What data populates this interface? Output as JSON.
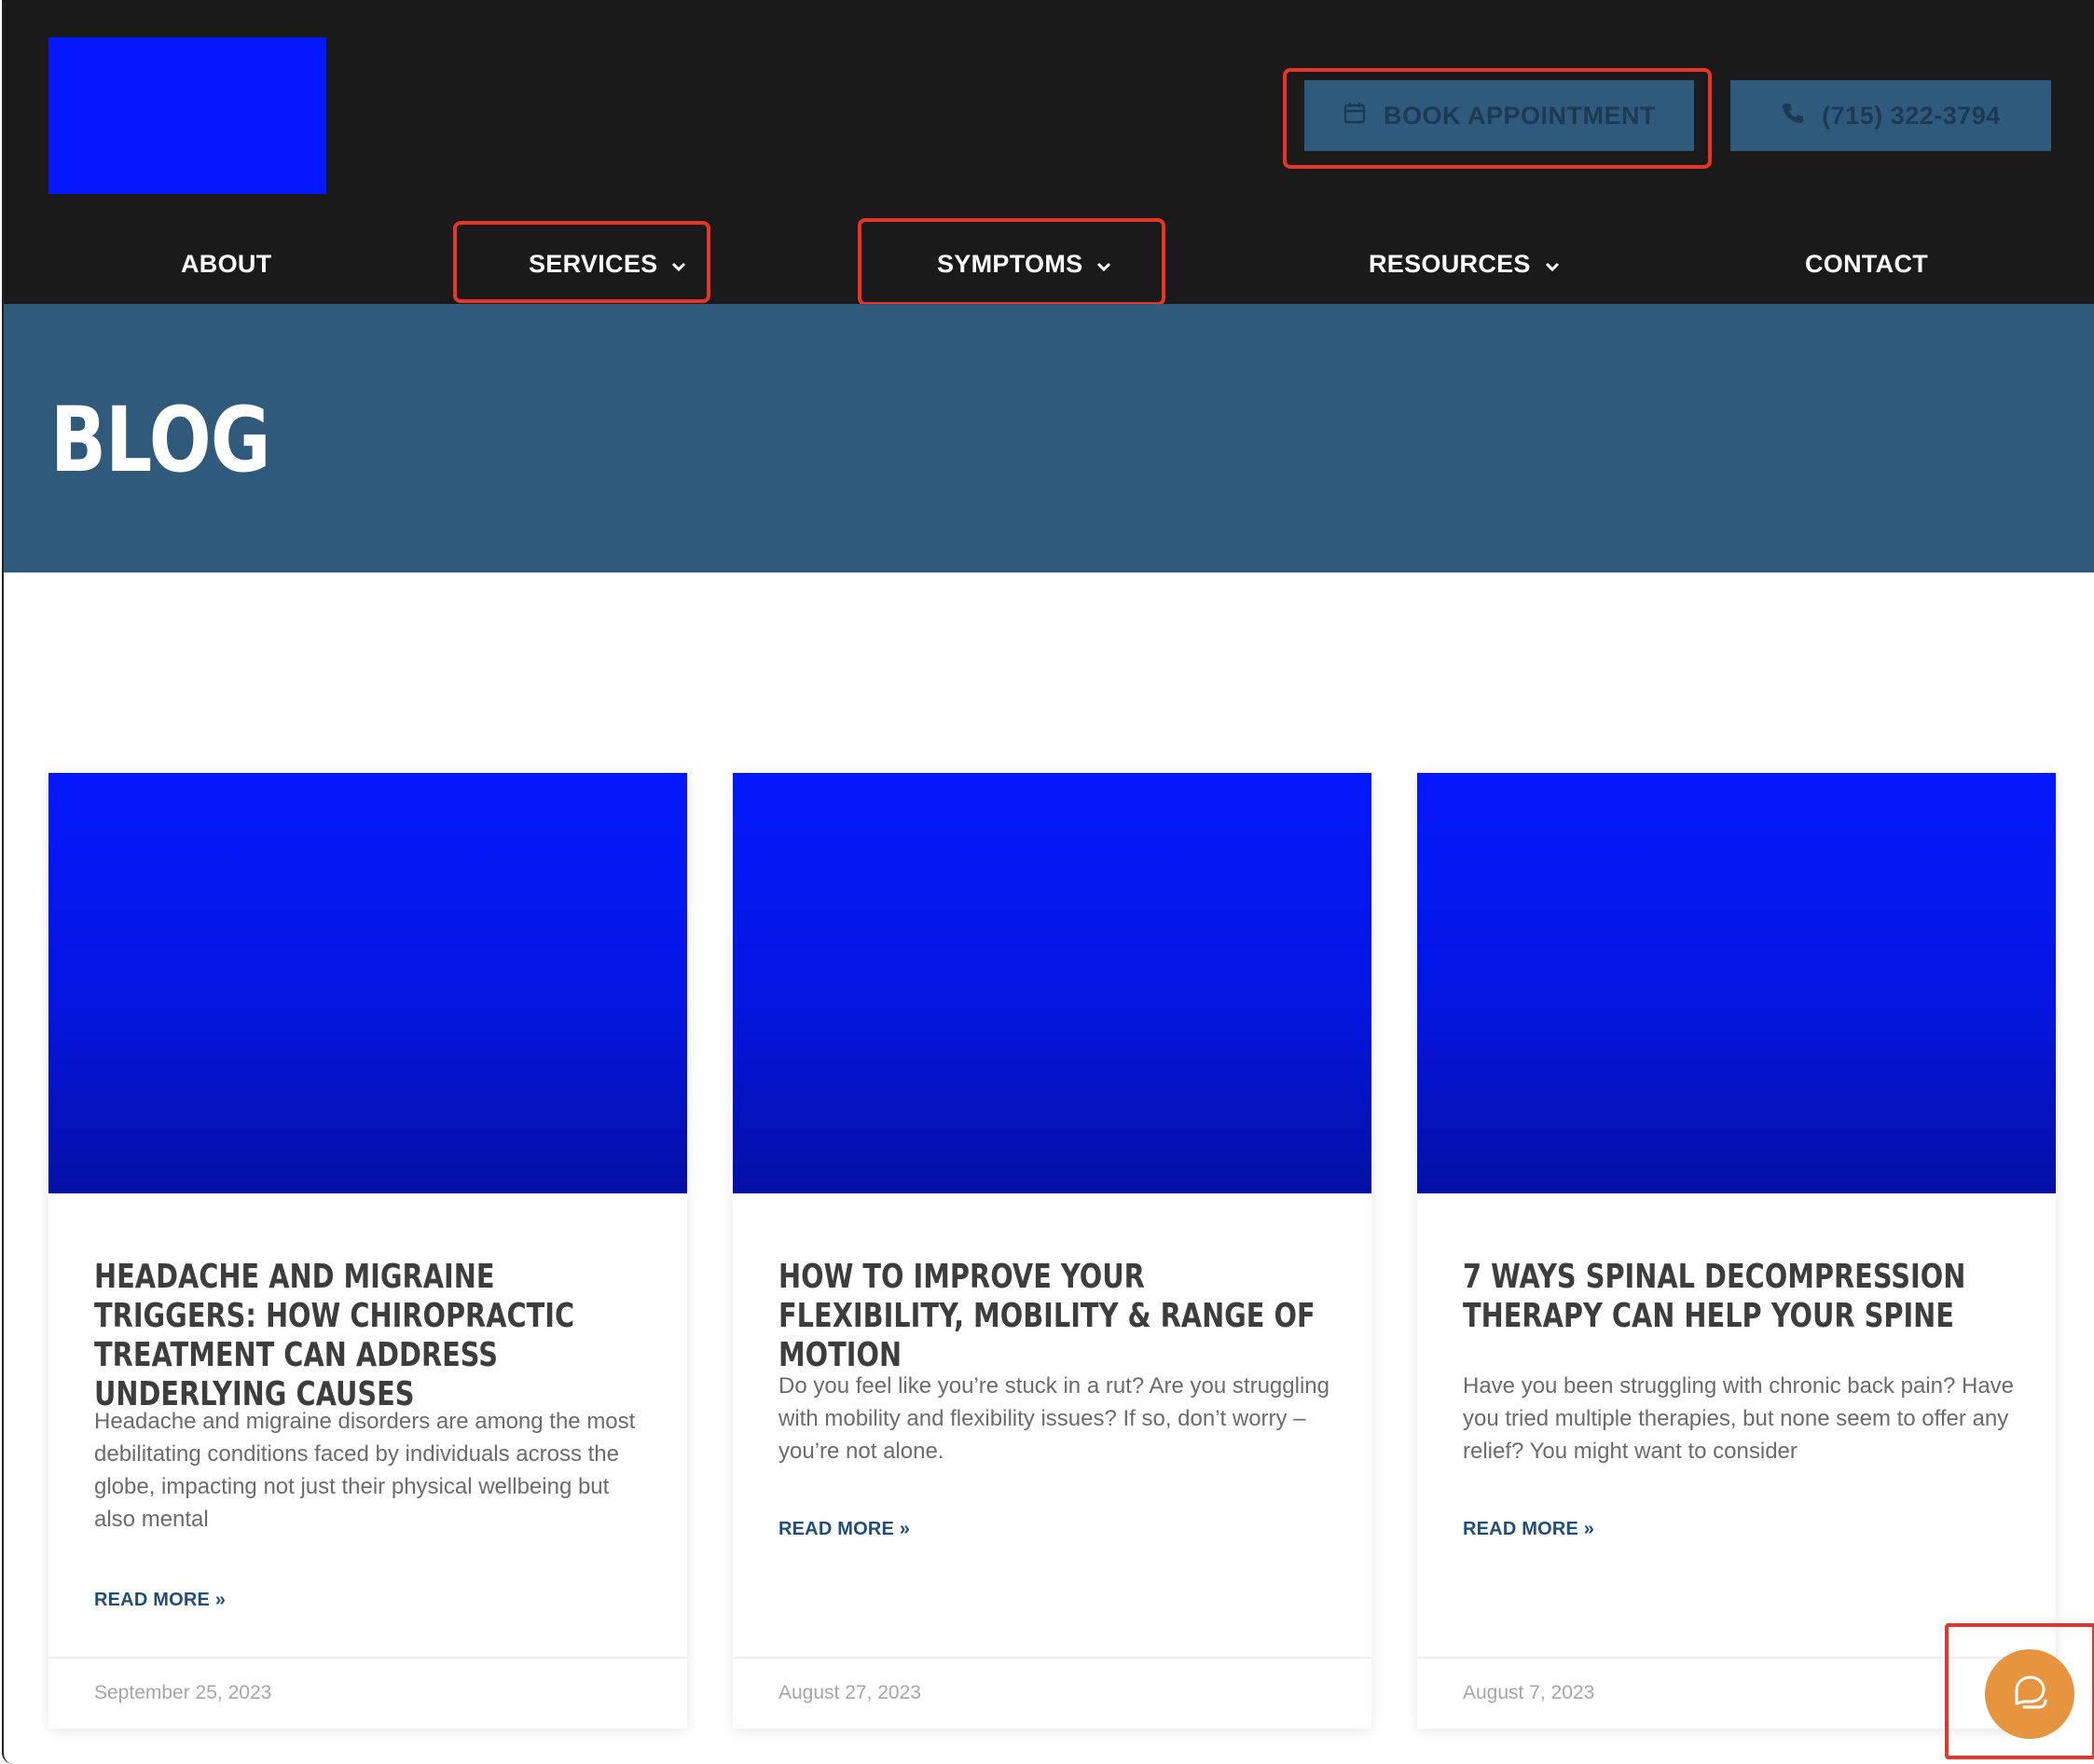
{
  "header": {
    "logo_alt": "",
    "book_label": "BOOK APPOINTMENT",
    "phone_label": "(715) 322-3794",
    "nav": [
      {
        "label": "ABOUT",
        "has_dropdown": false
      },
      {
        "label": "SERVICES",
        "has_dropdown": true
      },
      {
        "label": "SYMPTOMS",
        "has_dropdown": true
      },
      {
        "label": "RESOURCES",
        "has_dropdown": true
      },
      {
        "label": "CONTACT",
        "has_dropdown": false
      }
    ]
  },
  "hero": {
    "title": "BLOG"
  },
  "posts": [
    {
      "title": "HEADACHE AND MIGRAINE TRIGGERS: HOW CHIROPRACTIC TREATMENT CAN ADDRESS UNDERLYING CAUSES",
      "excerpt": "Headache and migraine disorders are among the most debilitating conditions faced by individuals across the globe, impacting not just their physical wellbeing but also mental",
      "read_more": "READ MORE »",
      "date": "September 25, 2023"
    },
    {
      "title": "HOW TO IMPROVE YOUR FLEXIBILITY, MOBILITY & RANGE OF MOTION",
      "excerpt": "Do you feel like you’re stuck in a rut? Are you struggling with mobility and flexibility issues? If so, don’t worry – you’re not alone.",
      "read_more": "READ MORE »",
      "date": "August 27, 2023"
    },
    {
      "title": "7 WAYS SPINAL DECOMPRESSION THERAPY CAN HELP YOUR SPINE",
      "excerpt": "Have you been struggling with chronic back pain? Have you tried multiple therapies, but none seem to offer any relief? You might want to consider",
      "read_more": "READ MORE »",
      "date": "August 7, 2023"
    }
  ],
  "colors": {
    "header_bg": "#1a1a1a",
    "logo_placeholder": "#0517ff",
    "button_bg": "#2f5a7c",
    "hero_bg": "#305a7c",
    "highlight": "#e63426",
    "link": "#1f4f79",
    "chat_button": "#e6943d"
  },
  "icons": {
    "book": "calendar-icon",
    "phone": "phone-icon",
    "dropdown": "chevron-down-icon",
    "chat": "chat-bubble-icon"
  }
}
